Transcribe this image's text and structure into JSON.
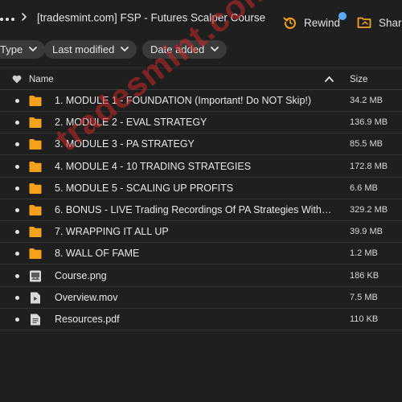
{
  "header": {
    "title": "[tradesmint.com] FSP - Futures Scalper Course",
    "rewind_label": "Rewind",
    "share_label": "Shar",
    "icons": [
      "more-dots-icon",
      "chevron-right-icon",
      "rewind-icon",
      "share-folder-icon"
    ],
    "accent_color": "#f4a21c",
    "notification_color": "#5aa9f7"
  },
  "filters": [
    {
      "label": "Type"
    },
    {
      "label": "Last modified"
    },
    {
      "label": "Date added"
    }
  ],
  "list": {
    "columns": {
      "name": "Name",
      "size": "Size"
    },
    "sort": "ascending",
    "rows": [
      {
        "name": "1. MODULE 1 - FOUNDATION (Important! Do NOT Skip!)",
        "size": "34.2 MB",
        "kind": "folder"
      },
      {
        "name": "2. MODULE 2 - EVAL STRATEGY",
        "size": "136.9 MB",
        "kind": "folder"
      },
      {
        "name": "3. MODULE 3 - PA STRATEGY",
        "size": "85.5 MB",
        "kind": "folder"
      },
      {
        "name": "4. MODULE 4 - 10 TRADING STRATEGIES",
        "size": "172.8 MB",
        "kind": "folder"
      },
      {
        "name": "5. MODULE 5 - SCALING UP PROFITS",
        "size": "6.6 MB",
        "kind": "folder"
      },
      {
        "name": "6. BONUS - LIVE Trading Recordings Of PA Strategies With ...",
        "size": "329.2 MB",
        "kind": "folder"
      },
      {
        "name": "7. WRAPPING IT ALL UP",
        "size": "39.9 MB",
        "kind": "folder"
      },
      {
        "name": "8. WALL OF FAME",
        "size": "1.2 MB",
        "kind": "folder"
      },
      {
        "name": "Course.png",
        "size": "186 KB",
        "kind": "image"
      },
      {
        "name": "Overview.mov",
        "size": "7.5 MB",
        "kind": "video"
      },
      {
        "name": "Resources.pdf",
        "size": "110 KB",
        "kind": "document"
      }
    ]
  },
  "watermark": {
    "text": "tradesmint.com",
    "color": "#c82828"
  }
}
